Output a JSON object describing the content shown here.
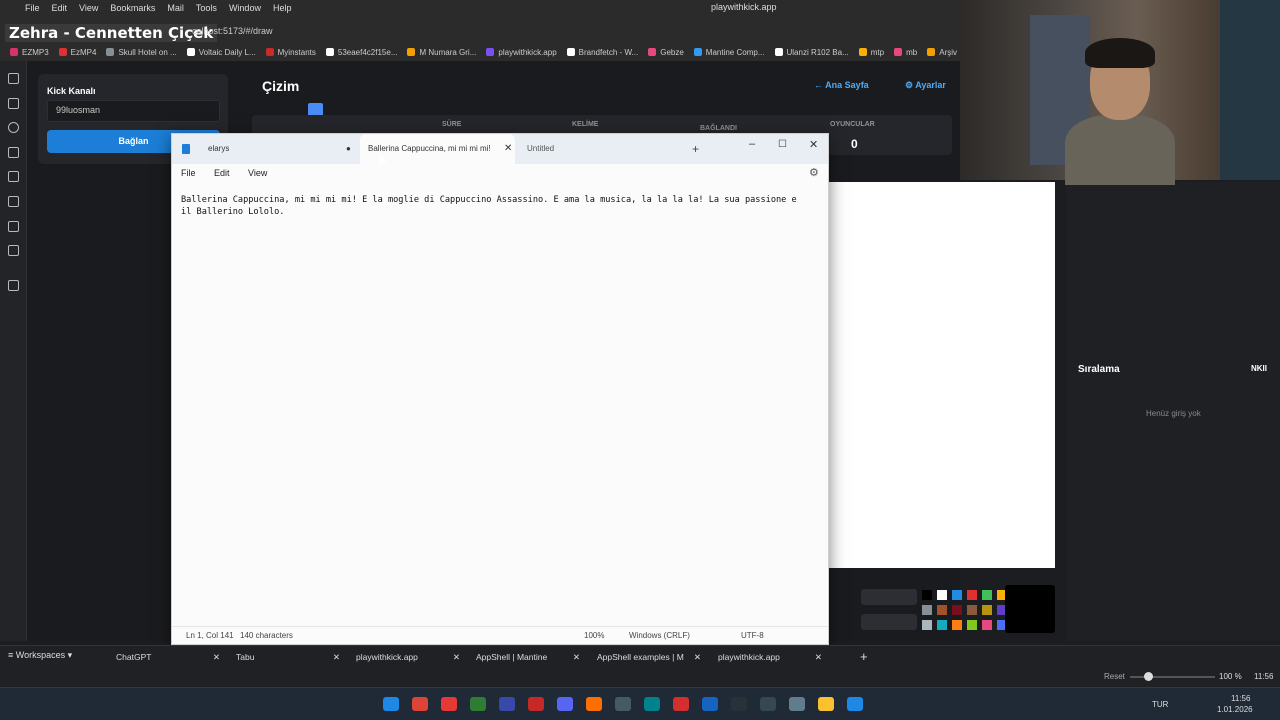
{
  "browser": {
    "menu": [
      "File",
      "Edit",
      "View",
      "Bookmarks",
      "Mail",
      "Tools",
      "Window",
      "Help"
    ],
    "window_title": "playwithkick.app",
    "song_overlay": "Zehra - Cennetten Çiçek",
    "url": "calhost:5173/#/draw",
    "bookmarks": [
      {
        "label": "EZMP3",
        "color": "#d6336c"
      },
      {
        "label": "EzMP4",
        "color": "#e03131"
      },
      {
        "label": "Skull Hotel on ...",
        "color": "#868e96"
      },
      {
        "label": "Voltaic Daily L...",
        "color": "#ffffff"
      },
      {
        "label": "Myinstants",
        "color": "#c92a2a"
      },
      {
        "label": "53eaef4c2f15e...",
        "color": "#ffffff"
      },
      {
        "label": "M Numara Gri...",
        "color": "#f59f00"
      },
      {
        "label": "playwithkick.app",
        "color": "#7950f2"
      },
      {
        "label": "Brandfetch - W...",
        "color": "#ffffff"
      },
      {
        "label": "Gebze",
        "color": "#e64980"
      },
      {
        "label": "Mantine Comp...",
        "color": "#339af0"
      },
      {
        "label": "Ulanzi R102 Ba...",
        "color": "#ffffff"
      },
      {
        "label": "mtp",
        "color": "#fab005"
      },
      {
        "label": "mb",
        "color": "#e64980"
      },
      {
        "label": "Arşiv",
        "color": "#f59f00"
      }
    ],
    "tabs": [
      {
        "label": "ChatGPT"
      },
      {
        "label": "Tabu"
      },
      {
        "label": "playwithkick.app"
      },
      {
        "label": "AppShell | Mantine"
      },
      {
        "label": "AppShell examples | M"
      },
      {
        "label": "playwithkick.app"
      }
    ],
    "workspaces": "Workspaces",
    "zoom_reset": "Reset",
    "zoom": "100 %",
    "clock_small": "11:56"
  },
  "app": {
    "kick_channel_label": "Kick Kanalı",
    "kick_channel_value": "99luosman",
    "connect_label": "Bağlan",
    "page_title": "Çizim",
    "home_label": "Ana Sayfa",
    "settings_label": "Ayarlar",
    "stats": {
      "time_label": "SÜRE",
      "word_label": "KELİME",
      "connected_label": "BAĞLANDI",
      "players_label": "OYUNCULAR",
      "players_value": "0"
    },
    "ranking_title": "Sıralama",
    "ranking_kick": "NKII",
    "ranking_empty": "Henüz giriş yok",
    "palette": [
      "#000000",
      "#ffffff",
      "#228be6",
      "#e03131",
      "#40c057",
      "#fab005",
      "#868e96",
      "#a0522d",
      "#7a0e1e",
      "#8b5a3c",
      "#b59410",
      "#5f3dc4",
      "#adb5bd",
      "#15aabf",
      "#fd7e14",
      "#82c91e",
      "#e64980",
      "#4c6ef5"
    ]
  },
  "notepad": {
    "tabs": [
      {
        "label": "elarys"
      },
      {
        "label": "Ballerina Cappuccina, mi mi mi mi!"
      },
      {
        "label": "Untitled"
      }
    ],
    "menu": [
      "File",
      "Edit",
      "View"
    ],
    "text": "Ballerina Cappuccina, mi mi mi mi! E la moglie di Cappuccino Assassino. E ama la musica, la la la la! La sua passione e\nil Ballerino Lololo.",
    "status": {
      "position": "Ln 1, Col 141",
      "chars": "140 characters",
      "zoom": "100%",
      "line_ending": "Windows (CRLF)",
      "encoding": "UTF-8"
    }
  },
  "system": {
    "lang": "TUR",
    "time": "11:56",
    "date": "1.01.2026"
  }
}
